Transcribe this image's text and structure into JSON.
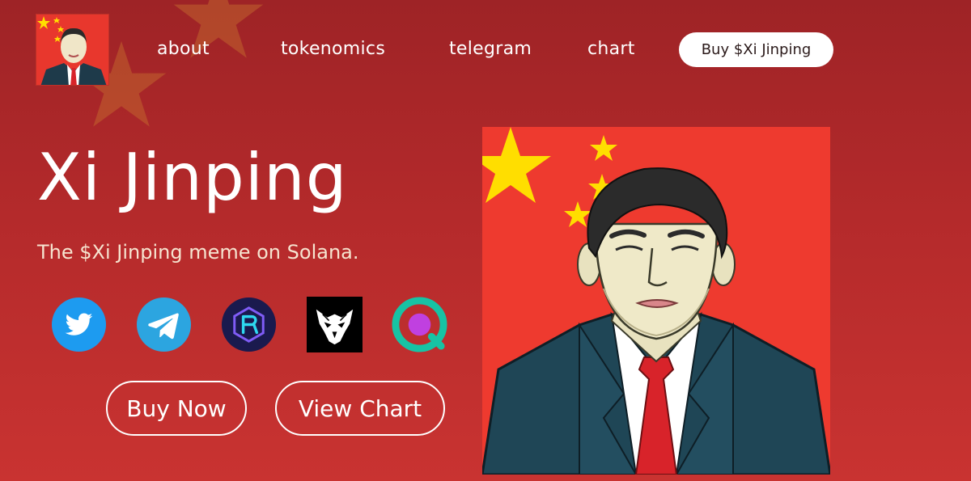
{
  "brand": {
    "logo_icon": "xi-jinping-portrait",
    "flag_red": "#ee3a2f",
    "star_yellow": "#ffde00"
  },
  "nav": {
    "items": [
      {
        "label": "about"
      },
      {
        "label": "tokenomics"
      },
      {
        "label": "telegram"
      },
      {
        "label": "chart"
      }
    ],
    "buy_label": "Buy $Xi Jinping"
  },
  "hero": {
    "title": "Xi Jinping",
    "subtitle": "The $Xi Jinping meme on Solana."
  },
  "socials": [
    {
      "icon": "twitter-icon",
      "color": "#1d9bf0"
    },
    {
      "icon": "telegram-icon",
      "color": "#2ca5e0"
    },
    {
      "icon": "raydium-icon",
      "color": "#1a1a4e"
    },
    {
      "icon": "birdeye-icon",
      "color": "#000000"
    },
    {
      "icon": "dexscreener-icon",
      "color": "#17c3a4"
    }
  ],
  "cta": {
    "buy_now": "Buy Now",
    "view_chart": "View Chart"
  },
  "colors": {
    "background_top": "#9e2326",
    "background_bottom": "#c93331",
    "button_bg": "#ffffff"
  }
}
